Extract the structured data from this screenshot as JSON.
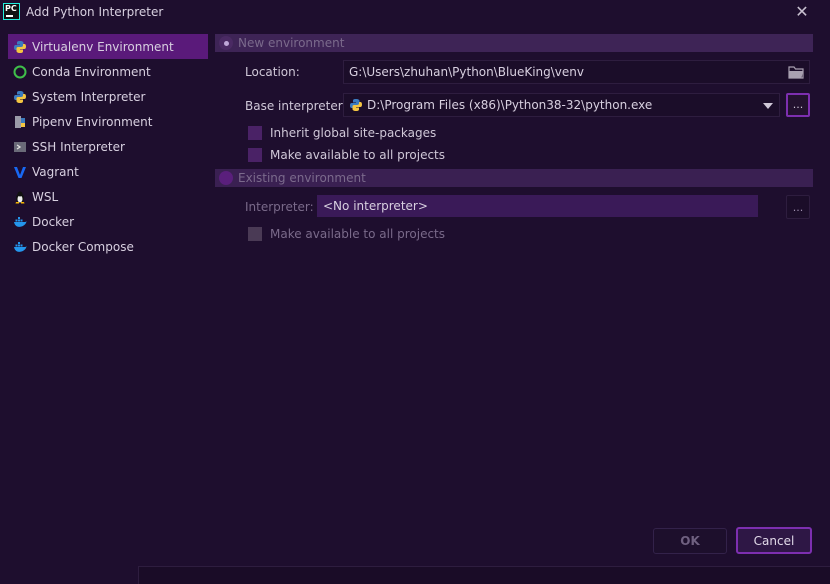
{
  "window": {
    "title": "Add Python Interpreter",
    "icon_text": "PC",
    "close_glyph": "✕"
  },
  "sidebar": {
    "items": [
      {
        "label": "Virtualenv Environment",
        "icon": "python-icon",
        "selected": true
      },
      {
        "label": "Conda Environment",
        "icon": "conda-icon",
        "selected": false
      },
      {
        "label": "System Interpreter",
        "icon": "python-icon",
        "selected": false
      },
      {
        "label": "Pipenv Environment",
        "icon": "pipenv-icon",
        "selected": false
      },
      {
        "label": "SSH Interpreter",
        "icon": "ssh-icon",
        "selected": false
      },
      {
        "label": "Vagrant",
        "icon": "vagrant-icon",
        "selected": false
      },
      {
        "label": "WSL",
        "icon": "linux-icon",
        "selected": false
      },
      {
        "label": "Docker",
        "icon": "docker-icon",
        "selected": false
      },
      {
        "label": "Docker Compose",
        "icon": "docker-icon",
        "selected": false
      }
    ]
  },
  "new_env": {
    "label": "New environment",
    "selected": true,
    "location_label": "Location:",
    "location_value": "G:\\Users\\zhuhan\\Python\\BlueKing\\venv",
    "base_label": "Base interpreter:",
    "base_value": "D:\\Program Files (x86)\\Python38-32\\python.exe",
    "browse_label": "...",
    "inherit_label": "Inherit global site-packages",
    "available_label": "Make available to all projects"
  },
  "existing_env": {
    "label": "Existing environment",
    "selected": false,
    "interpreter_label": "Interpreter:",
    "interpreter_value": "<No interpreter>",
    "browse_label": "...",
    "available_label": "Make available to all projects"
  },
  "buttons": {
    "ok": "OK",
    "cancel": "Cancel"
  },
  "colors": {
    "accent": "#7d2fb0",
    "selected_bg": "#5a1a7a",
    "background": "#1e0e2e"
  }
}
